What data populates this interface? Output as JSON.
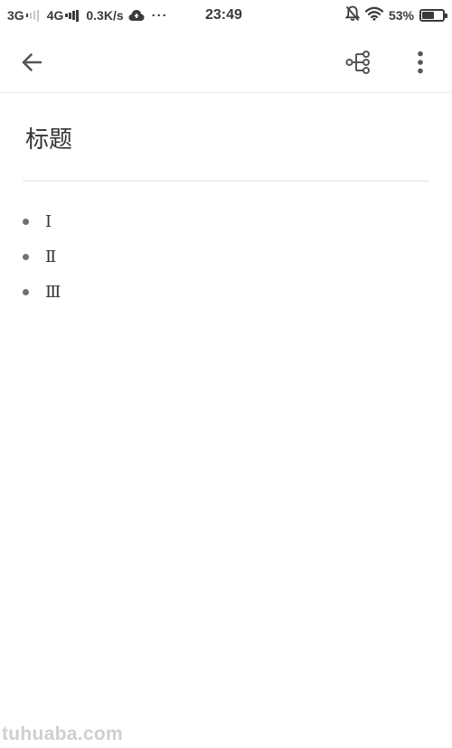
{
  "status_bar": {
    "network1": "3G",
    "network2": "4G",
    "speed": "0.3K/s",
    "more_dots": "···",
    "time": "23:49",
    "battery_pct": "53%",
    "battery_level": 0.53,
    "icons": [
      "signal-icon",
      "cloud-icon",
      "bell-off-icon",
      "wifi-icon",
      "battery-icon"
    ]
  },
  "toolbar": {
    "icons": [
      "back-arrow-icon",
      "mindmap-icon",
      "more-vert-icon"
    ]
  },
  "note": {
    "title": "标题",
    "items": [
      {
        "text": "Ⅰ"
      },
      {
        "text": "Ⅱ"
      },
      {
        "text": "Ⅲ"
      }
    ]
  },
  "watermark": "tuhuaba.com",
  "colors": {
    "text": "#333333",
    "icon": "#555555",
    "divider": "#e2e2e2",
    "watermark": "#cfcfcf"
  }
}
